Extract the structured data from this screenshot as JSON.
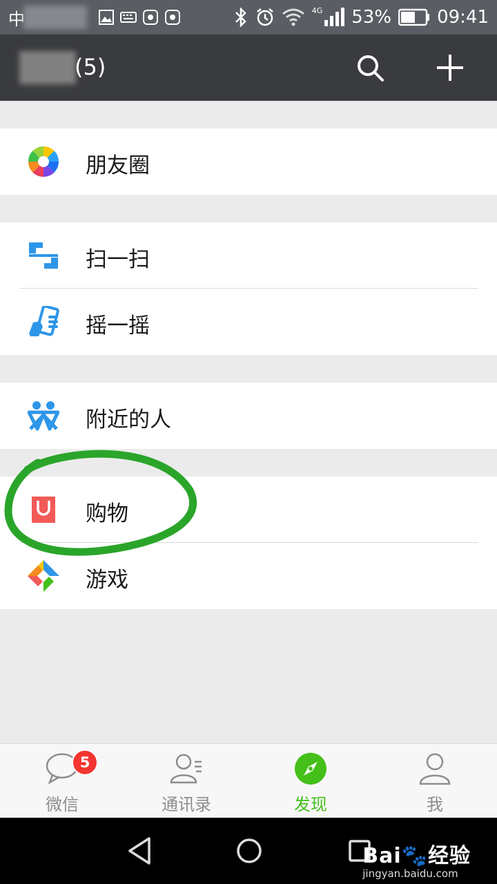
{
  "status_bar": {
    "carrier": "中",
    "network": "4G",
    "battery": "53%",
    "time": "09:41"
  },
  "header": {
    "title": "(5)"
  },
  "menu": {
    "moments": "朋友圈",
    "scan": "扫一扫",
    "shake": "摇一摇",
    "nearby": "附近的人",
    "shopping": "购物",
    "games": "游戏"
  },
  "tabs": [
    {
      "label": "微信",
      "badge": "5"
    },
    {
      "label": "通讯录"
    },
    {
      "label": "发现"
    },
    {
      "label": "我"
    }
  ],
  "watermark": {
    "brand": "Bai",
    "brand_suffix": "经验",
    "url": "jingyan.baidu.com"
  },
  "colors": {
    "accent": "#45c01a",
    "badge": "#f43530",
    "header": "#3a3b3f",
    "annotation": "#2aa52a"
  }
}
